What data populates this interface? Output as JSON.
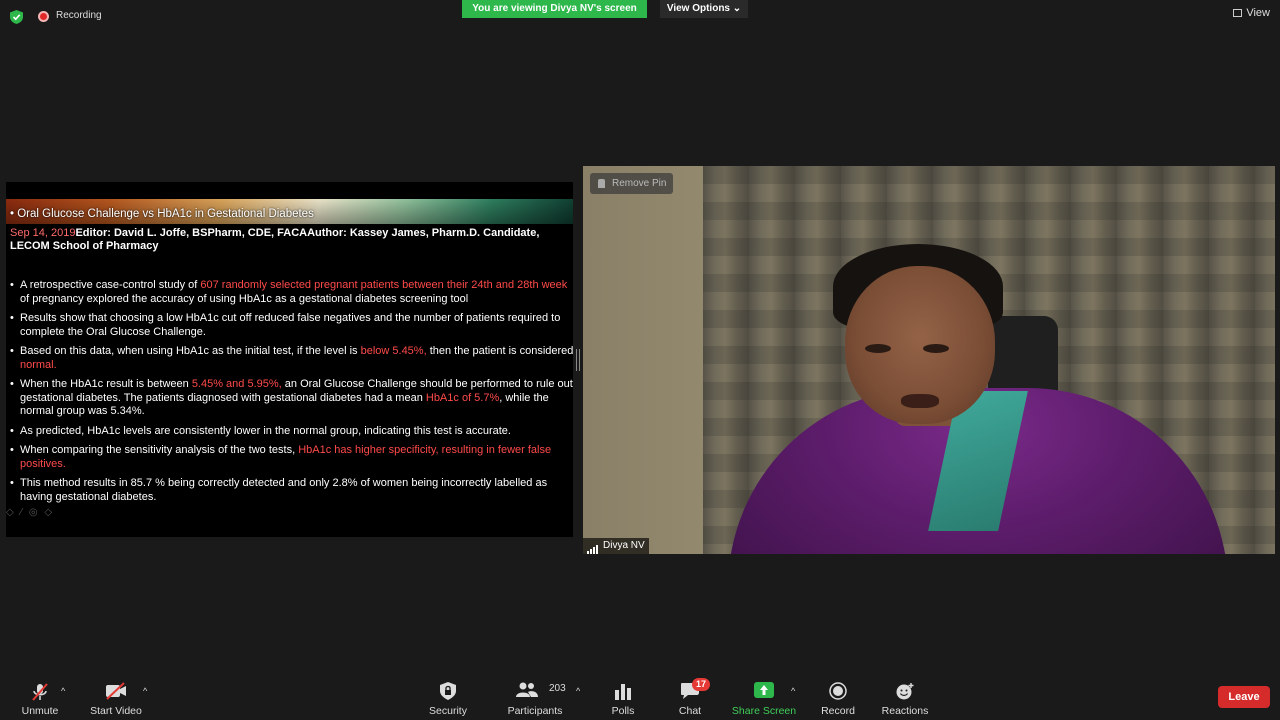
{
  "top_bar": {
    "recording_label": "Recording",
    "viewing_banner": "You are viewing Divya NV's screen",
    "view_options_label": "View Options ⌄",
    "view_label": "View"
  },
  "slide": {
    "title": "Oral Glucose Challenge vs HbA1c in Gestational Diabetes",
    "date": "Sep 14, 2019",
    "meta": "Editor: David L. Joffe, BSPharm, CDE, FACAAuthor: Kassey  James, Pharm.D. Candidate, LECOM School of Pharmacy",
    "bullets": [
      {
        "a": "A retrospective case-control study of ",
        "h": "607 randomly selected pregnant patients between their 24th and 28th week",
        "b": " of pregnancy explored the accuracy of using HbA1c as a gestational diabetes screening tool",
        "h2": "",
        "c": ""
      },
      {
        "a": "Results show that choosing a low HbA1c cut off reduced false negatives and the number of patients required to complete the Oral Glucose Challenge.",
        "h": "",
        "b": "",
        "h2": "",
        "c": ""
      },
      {
        "a": " Based on this data, when using HbA1c as the initial test, if the level is ",
        "h": "below 5.45%,",
        "b": " then the patient is considered ",
        "h2": "normal.",
        "c": ""
      },
      {
        "a": "When the HbA1c result is between ",
        "h": "5.45% and 5.95%,",
        "b": " an Oral Glucose Challenge should be performed to rule out gestational diabetes. The patients diagnosed with gestational diabetes had a mean ",
        "h2": "HbA1c of 5.7%",
        "c": ", while the normal group was 5.34%."
      },
      {
        "a": "As predicted, HbA1c levels are consistently lower in the normal group, indicating this test is accurate.",
        "h": "",
        "b": "",
        "h2": "",
        "c": ""
      },
      {
        "a": "When comparing the sensitivity analysis of the two tests, ",
        "h": "HbA1c has higher specificity, resulting in fewer false positives.",
        "b": "",
        "h2": "",
        "c": ""
      },
      {
        "a": "This method results in 85.7 % being correctly detected and only 2.8% of women being incorrectly labelled as having gestational diabetes.",
        "h": "",
        "b": "",
        "h2": "",
        "c": ""
      }
    ]
  },
  "video": {
    "remove_pin_label": "Remove Pin",
    "participant_name": "Divya NV"
  },
  "toolbar": {
    "unmute": "Unmute",
    "start_video": "Start Video",
    "security": "Security",
    "participants": "Participants",
    "participants_count": "203",
    "polls": "Polls",
    "chat": "Chat",
    "chat_badge": "17",
    "share_screen": "Share Screen",
    "record": "Record",
    "reactions": "Reactions",
    "leave": "Leave"
  },
  "colors": {
    "accent_green": "#2eb84b",
    "leave_red": "#d52b2b",
    "highlight_red": "#ff4a4a"
  }
}
